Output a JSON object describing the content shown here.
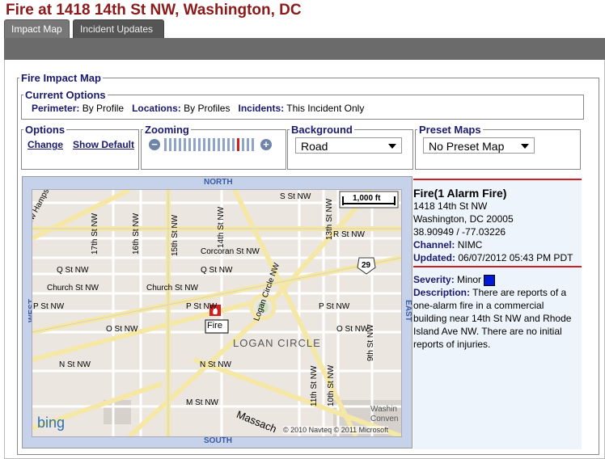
{
  "page": {
    "title": "Fire at 1418 14th St NW, Washington, DC"
  },
  "tabs": [
    {
      "label": "Impact Map"
    },
    {
      "label": "Incident Updates"
    }
  ],
  "main_legend": "Fire Impact Map",
  "current_options": {
    "legend": "Current Options",
    "perimeter_label": "Perimeter:",
    "perimeter_value": "By Profile",
    "locations_label": "Locations:",
    "locations_value": "By Profiles",
    "incidents_label": "Incidents:",
    "incidents_value": "This Incident Only"
  },
  "options": {
    "legend": "Options",
    "change": "Change",
    "show_default": "Show Default"
  },
  "zooming": {
    "legend": "Zooming",
    "minus": "−",
    "plus": "+",
    "levels": 19,
    "current_level": 15
  },
  "background": {
    "legend": "Background",
    "selected": "Road"
  },
  "preset": {
    "legend": "Preset Maps",
    "selected": "No Preset Map"
  },
  "map": {
    "compass": {
      "north": "NORTH",
      "south": "SOUTH",
      "east": "EAST",
      "west": "WEST"
    },
    "scale": "1,000 ft",
    "marker_label": "Fire",
    "area_label": "LOGAN CIRCLE",
    "provider": "bing",
    "copyright": "© 2010 Navteq © 2011 Microsoft",
    "highway_shield": "29",
    "streets": {
      "s_st_nw": "S St NW",
      "r_st_nw": "R St NW",
      "corcoran": "Corcoran St NW",
      "q_st_left": "Q St NW",
      "q_st_mid": "Q St NW",
      "church_left": "Church St NW",
      "church_mid": "Church St NW",
      "p_st_left": "P St NW",
      "p_st_mid": "P St NW",
      "p_st_right": "P St NW",
      "o_st_left": "O St NW",
      "o_st_right": "O St NW",
      "n_st_left": "N St NW",
      "n_st_mid": "N St NW",
      "m_st_nw": "M St NW",
      "new_hampshire": "New Hampshire Ave NW",
      "st17": "17th St NW",
      "st16": "16th St NW",
      "st15": "15th St NW",
      "st14": "14th St NW",
      "st13": "13th St NW",
      "st11": "11th St NW",
      "st10": "10th St NW",
      "st9": "9th St NW",
      "logan_circle": "Logan Circle NW",
      "massachusetts": "Massach",
      "washington": "Washin",
      "convention": "Conven"
    }
  },
  "incident": {
    "title": "Fire(1 Alarm Fire)",
    "address1": "1418 14th St NW",
    "address2": "Washington, DC 20005",
    "coords": "38.90949 / -77.03226",
    "channel_label": "Channel:",
    "channel_value": "NIMC",
    "updated_label": "Updated:",
    "updated_value": "06/07/2012 05:43 PM PDT",
    "severity_label": "Severity:",
    "severity_value": "Minor",
    "severity_color": "#0018d8",
    "description_label": "Description:",
    "description_line1": "There are reports of a",
    "description_line2": "one-alarm fire in a commercial",
    "description_line3": "building near 14th St NW and Rhode",
    "description_line4": "Island Ave NW. There are no initial",
    "description_line5": "reports of injuries."
  },
  "colors": {
    "title": "#8b1a1a",
    "label": "#1a1a6e",
    "accent": "#d21e1e"
  }
}
